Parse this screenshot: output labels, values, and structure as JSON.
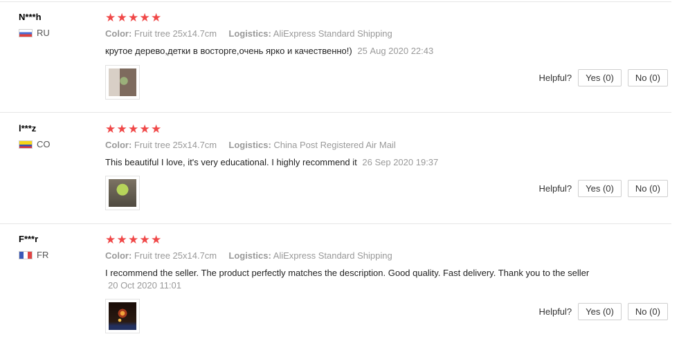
{
  "helpful_label": "Helpful?",
  "star_icon": "★",
  "colors": {
    "star": "#f04848",
    "muted_text": "#999999",
    "divider": "#e6e6e6"
  },
  "reviews": [
    {
      "user": "N***h",
      "country": "RU",
      "flag": "russia-flag-icon",
      "rating": 5,
      "color_label": "Color:",
      "color_value": "Fruit tree 25x14.7cm",
      "logistics_label": "Logistics:",
      "logistics_value": "AliExpress Standard Shipping",
      "text": "крутое дерево,детки в восторге,очень ярко и качественно!)",
      "date": "25 Aug 2020 22:43",
      "yes": "Yes (0)",
      "no": "No (0)"
    },
    {
      "user": "l***z",
      "country": "CO",
      "flag": "colombia-flag-icon",
      "rating": 5,
      "color_label": "Color:",
      "color_value": "Fruit tree 25x14.7cm",
      "logistics_label": "Logistics:",
      "logistics_value": "China Post Registered Air Mail",
      "text": "This beautiful I love, it's very educational. I highly recommend it",
      "date": "26 Sep 2020 19:37",
      "yes": "Yes (0)",
      "no": "No (0)"
    },
    {
      "user": "F***r",
      "country": "FR",
      "flag": "france-flag-icon",
      "rating": 5,
      "color_label": "Color:",
      "color_value": "Fruit tree 25x14.7cm",
      "logistics_label": "Logistics:",
      "logistics_value": "AliExpress Standard Shipping",
      "text": "I recommend the seller. The product perfectly matches the description. Good quality. Fast delivery. Thank you to the seller",
      "date": "20 Oct 2020 11:01",
      "yes": "Yes (0)",
      "no": "No (0)"
    }
  ]
}
